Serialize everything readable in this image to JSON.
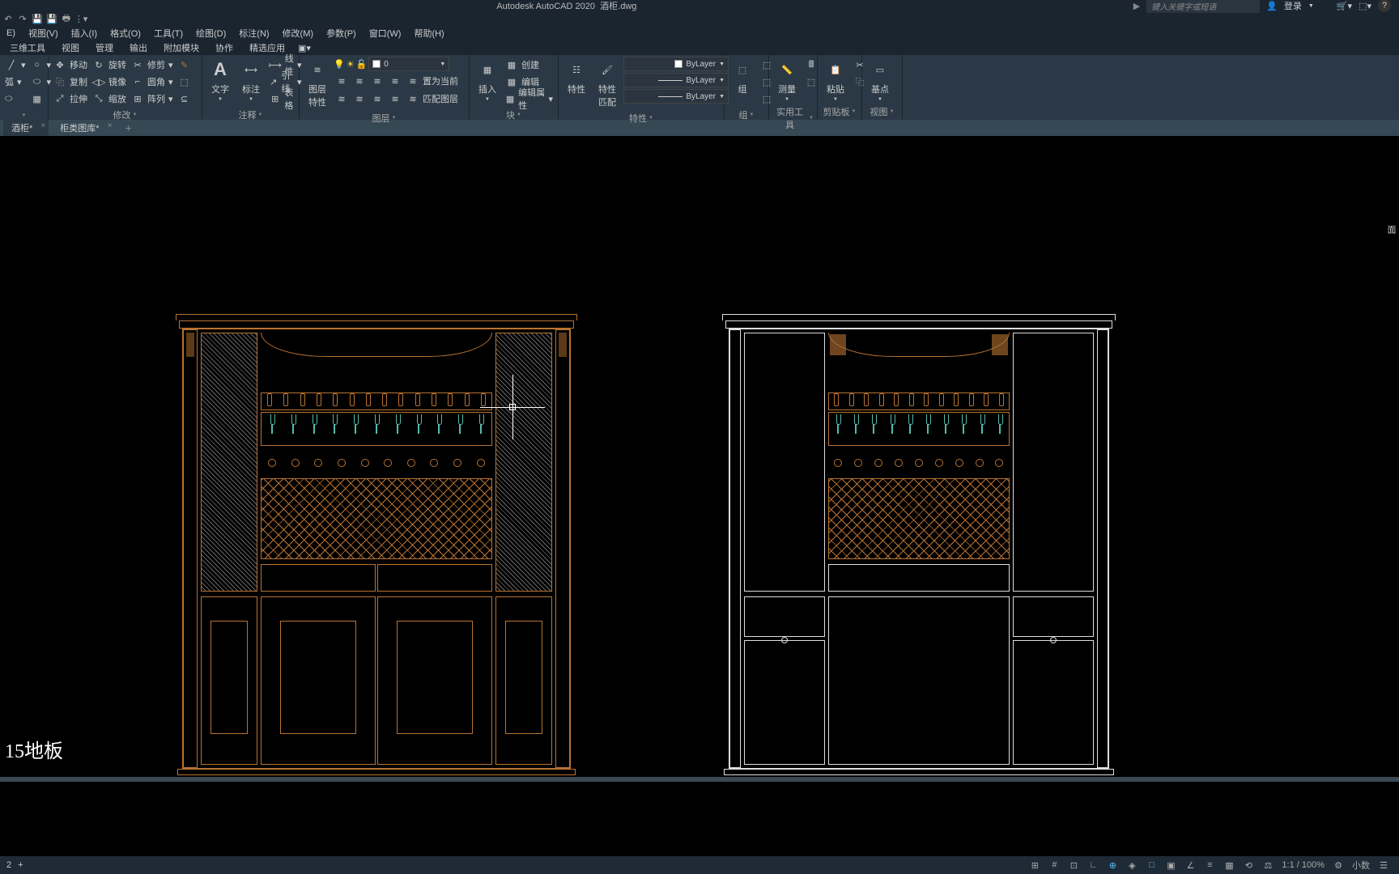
{
  "title": {
    "app": "Autodesk AutoCAD 2020",
    "file": "酒柜.dwg"
  },
  "search_placeholder": "键入关键字或短语",
  "login": "登录",
  "menus": [
    "E)",
    "视图(V)",
    "插入(I)",
    "格式(O)",
    "工具(T)",
    "绘图(D)",
    "标注(N)",
    "修改(M)",
    "参数(P)",
    "窗口(W)",
    "帮助(H)"
  ],
  "ribbon_tabs": [
    "三维工具",
    "视图",
    "管理",
    "输出",
    "附加模块",
    "协作",
    "精选应用"
  ],
  "ribbon": {
    "draw": {
      "label": "",
      "arc": "弧"
    },
    "modify": {
      "label": "修改",
      "move": "移动",
      "rotate": "旋转",
      "trim": "修剪",
      "copy": "复制",
      "mirror": "镜像",
      "fillet": "圆角",
      "stretch": "拉伸",
      "scale": "缩放",
      "array": "阵列"
    },
    "annotate": {
      "label": "注释",
      "text": "文字",
      "dim": "标注",
      "linear": "线性",
      "leader": "引线",
      "table": "表格"
    },
    "layers": {
      "label": "图层",
      "props": "图层\n特性",
      "current": "0",
      "setcurrent": "置为当前",
      "match": "匹配图层"
    },
    "block": {
      "label": "块",
      "insert": "插入",
      "create": "创建",
      "edit": "编辑",
      "editattr": "编辑属性"
    },
    "props": {
      "label": "特性",
      "props": "特性",
      "match": "特性\n匹配",
      "bylayer": "ByLayer"
    },
    "group": {
      "label": "组",
      "group": "组"
    },
    "utils": {
      "label": "实用工具",
      "measure": "测量"
    },
    "clip": {
      "label": "剪贴板",
      "paste": "粘贴"
    },
    "view": {
      "label": "视图",
      "base": "基点"
    }
  },
  "file_tabs": [
    {
      "name": "酒柜*",
      "active": true
    },
    {
      "name": "柜类图库*",
      "active": false
    }
  ],
  "annotation": "15地板",
  "status": {
    "scale": "1:1 / 100%",
    "dec": "小数",
    "layout1": "2",
    "plus": "+"
  }
}
